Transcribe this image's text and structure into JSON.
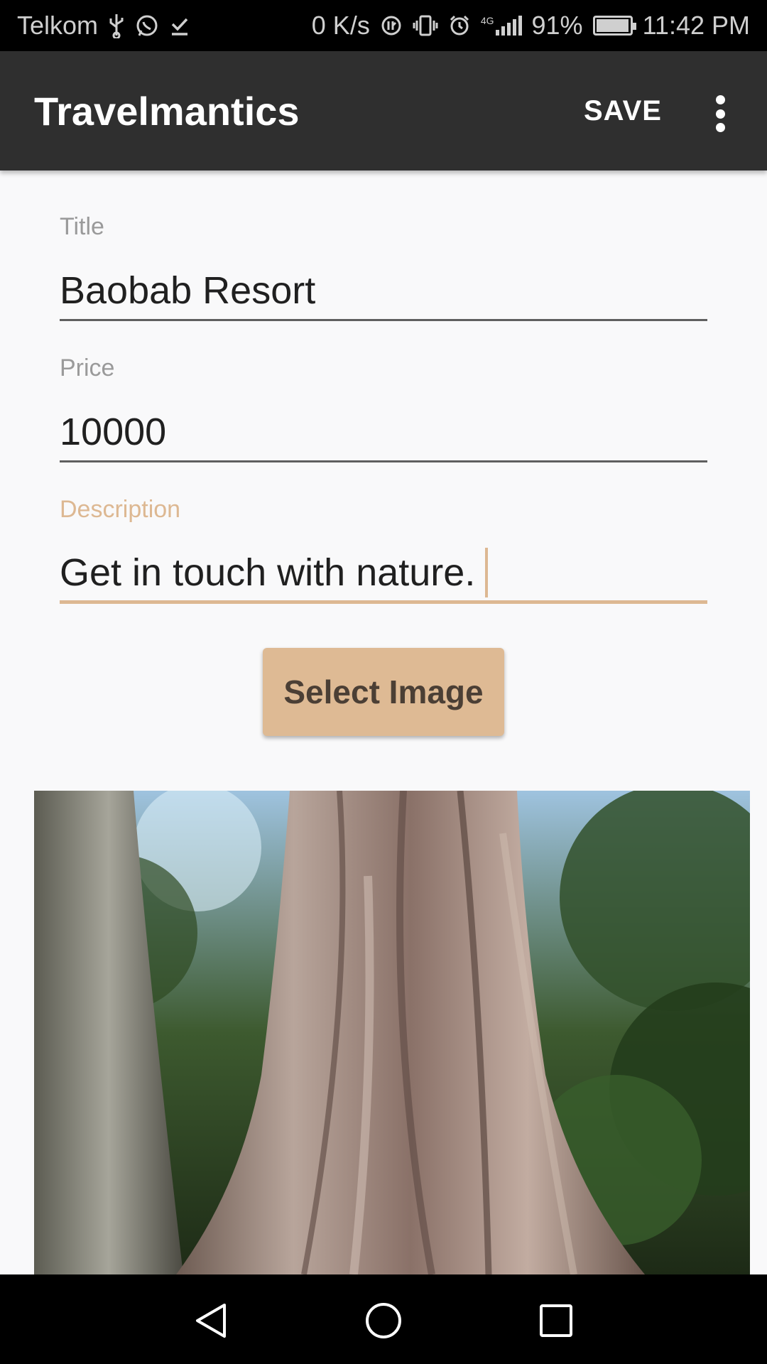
{
  "status_bar": {
    "carrier": "Telkom",
    "network_speed": "0 K/s",
    "network_type": "4G",
    "battery_percent": "91%",
    "battery_level": 0.91,
    "time": "11:42 PM",
    "icons": [
      "usb-icon",
      "whatsapp-icon",
      "download-done-icon",
      "data-saver-icon",
      "vibrate-icon",
      "alarm-icon",
      "signal-icon",
      "battery-icon"
    ]
  },
  "app_bar": {
    "title": "Travelmantics",
    "save_label": "SAVE",
    "overflow_icon": "more-vert-icon"
  },
  "form": {
    "title": {
      "label": "Title",
      "value": "Baobab Resort"
    },
    "price": {
      "label": "Price",
      "value": "10000"
    },
    "description": {
      "label": "Description",
      "value": "Get in touch with nature."
    }
  },
  "select_image_label": "Select Image",
  "colors": {
    "accent": "#ddb892",
    "button": "#deba94",
    "app_bar": "#2f2f2f",
    "background": "#f9f9fa"
  },
  "nav_bar": {
    "icons": [
      "back-icon",
      "home-icon",
      "recents-icon"
    ]
  }
}
